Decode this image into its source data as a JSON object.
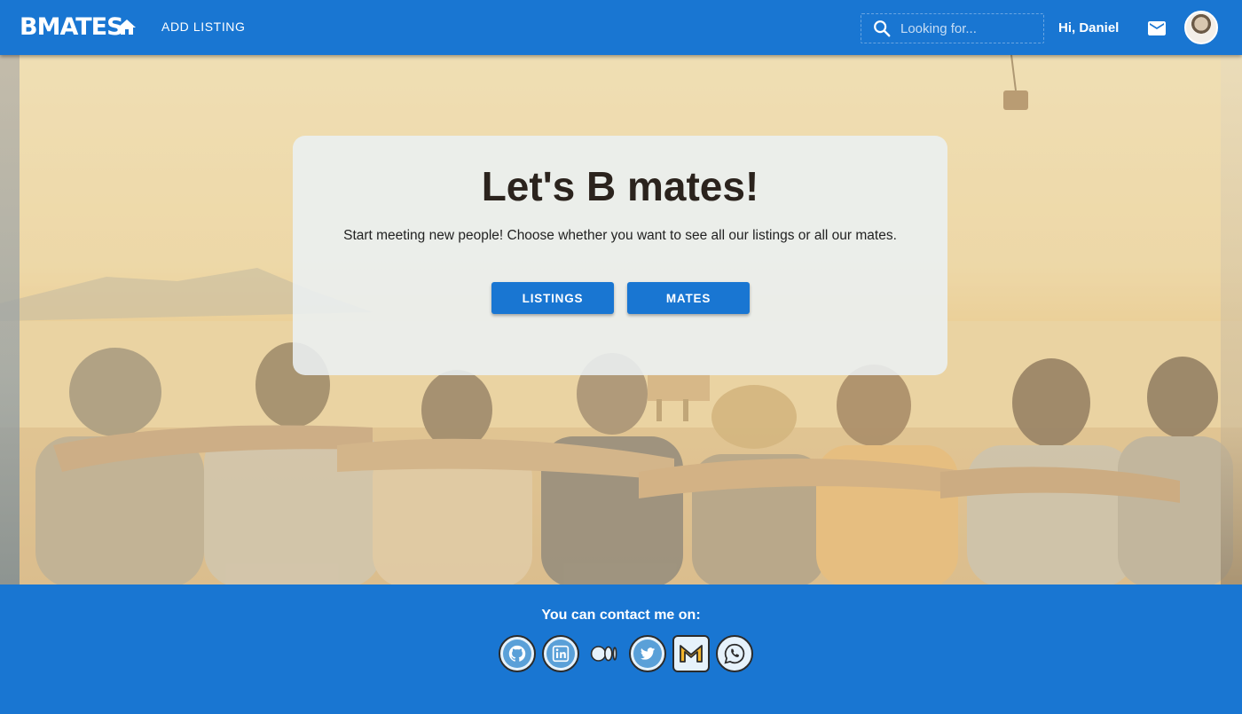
{
  "header": {
    "logo": "BMATES",
    "add_listing": "ADD LISTING",
    "search_placeholder": "Looking for...",
    "greeting": "Hi, Daniel"
  },
  "hero": {
    "title": "Let's B mates!",
    "subtitle": "Start meeting new people! Choose whether you want to see all our listings or all our mates.",
    "buttons": {
      "listings": "LISTINGS",
      "mates": "MATES"
    }
  },
  "footer": {
    "contact": "You can contact me on:",
    "socials": [
      "github-icon",
      "linkedin-icon",
      "medium-icon",
      "twitter-icon",
      "gmail-icon",
      "whatsapp-icon"
    ]
  },
  "colors": {
    "primary": "#1976d2",
    "card": "#eaf0f2",
    "title_text": "#2b231d"
  }
}
